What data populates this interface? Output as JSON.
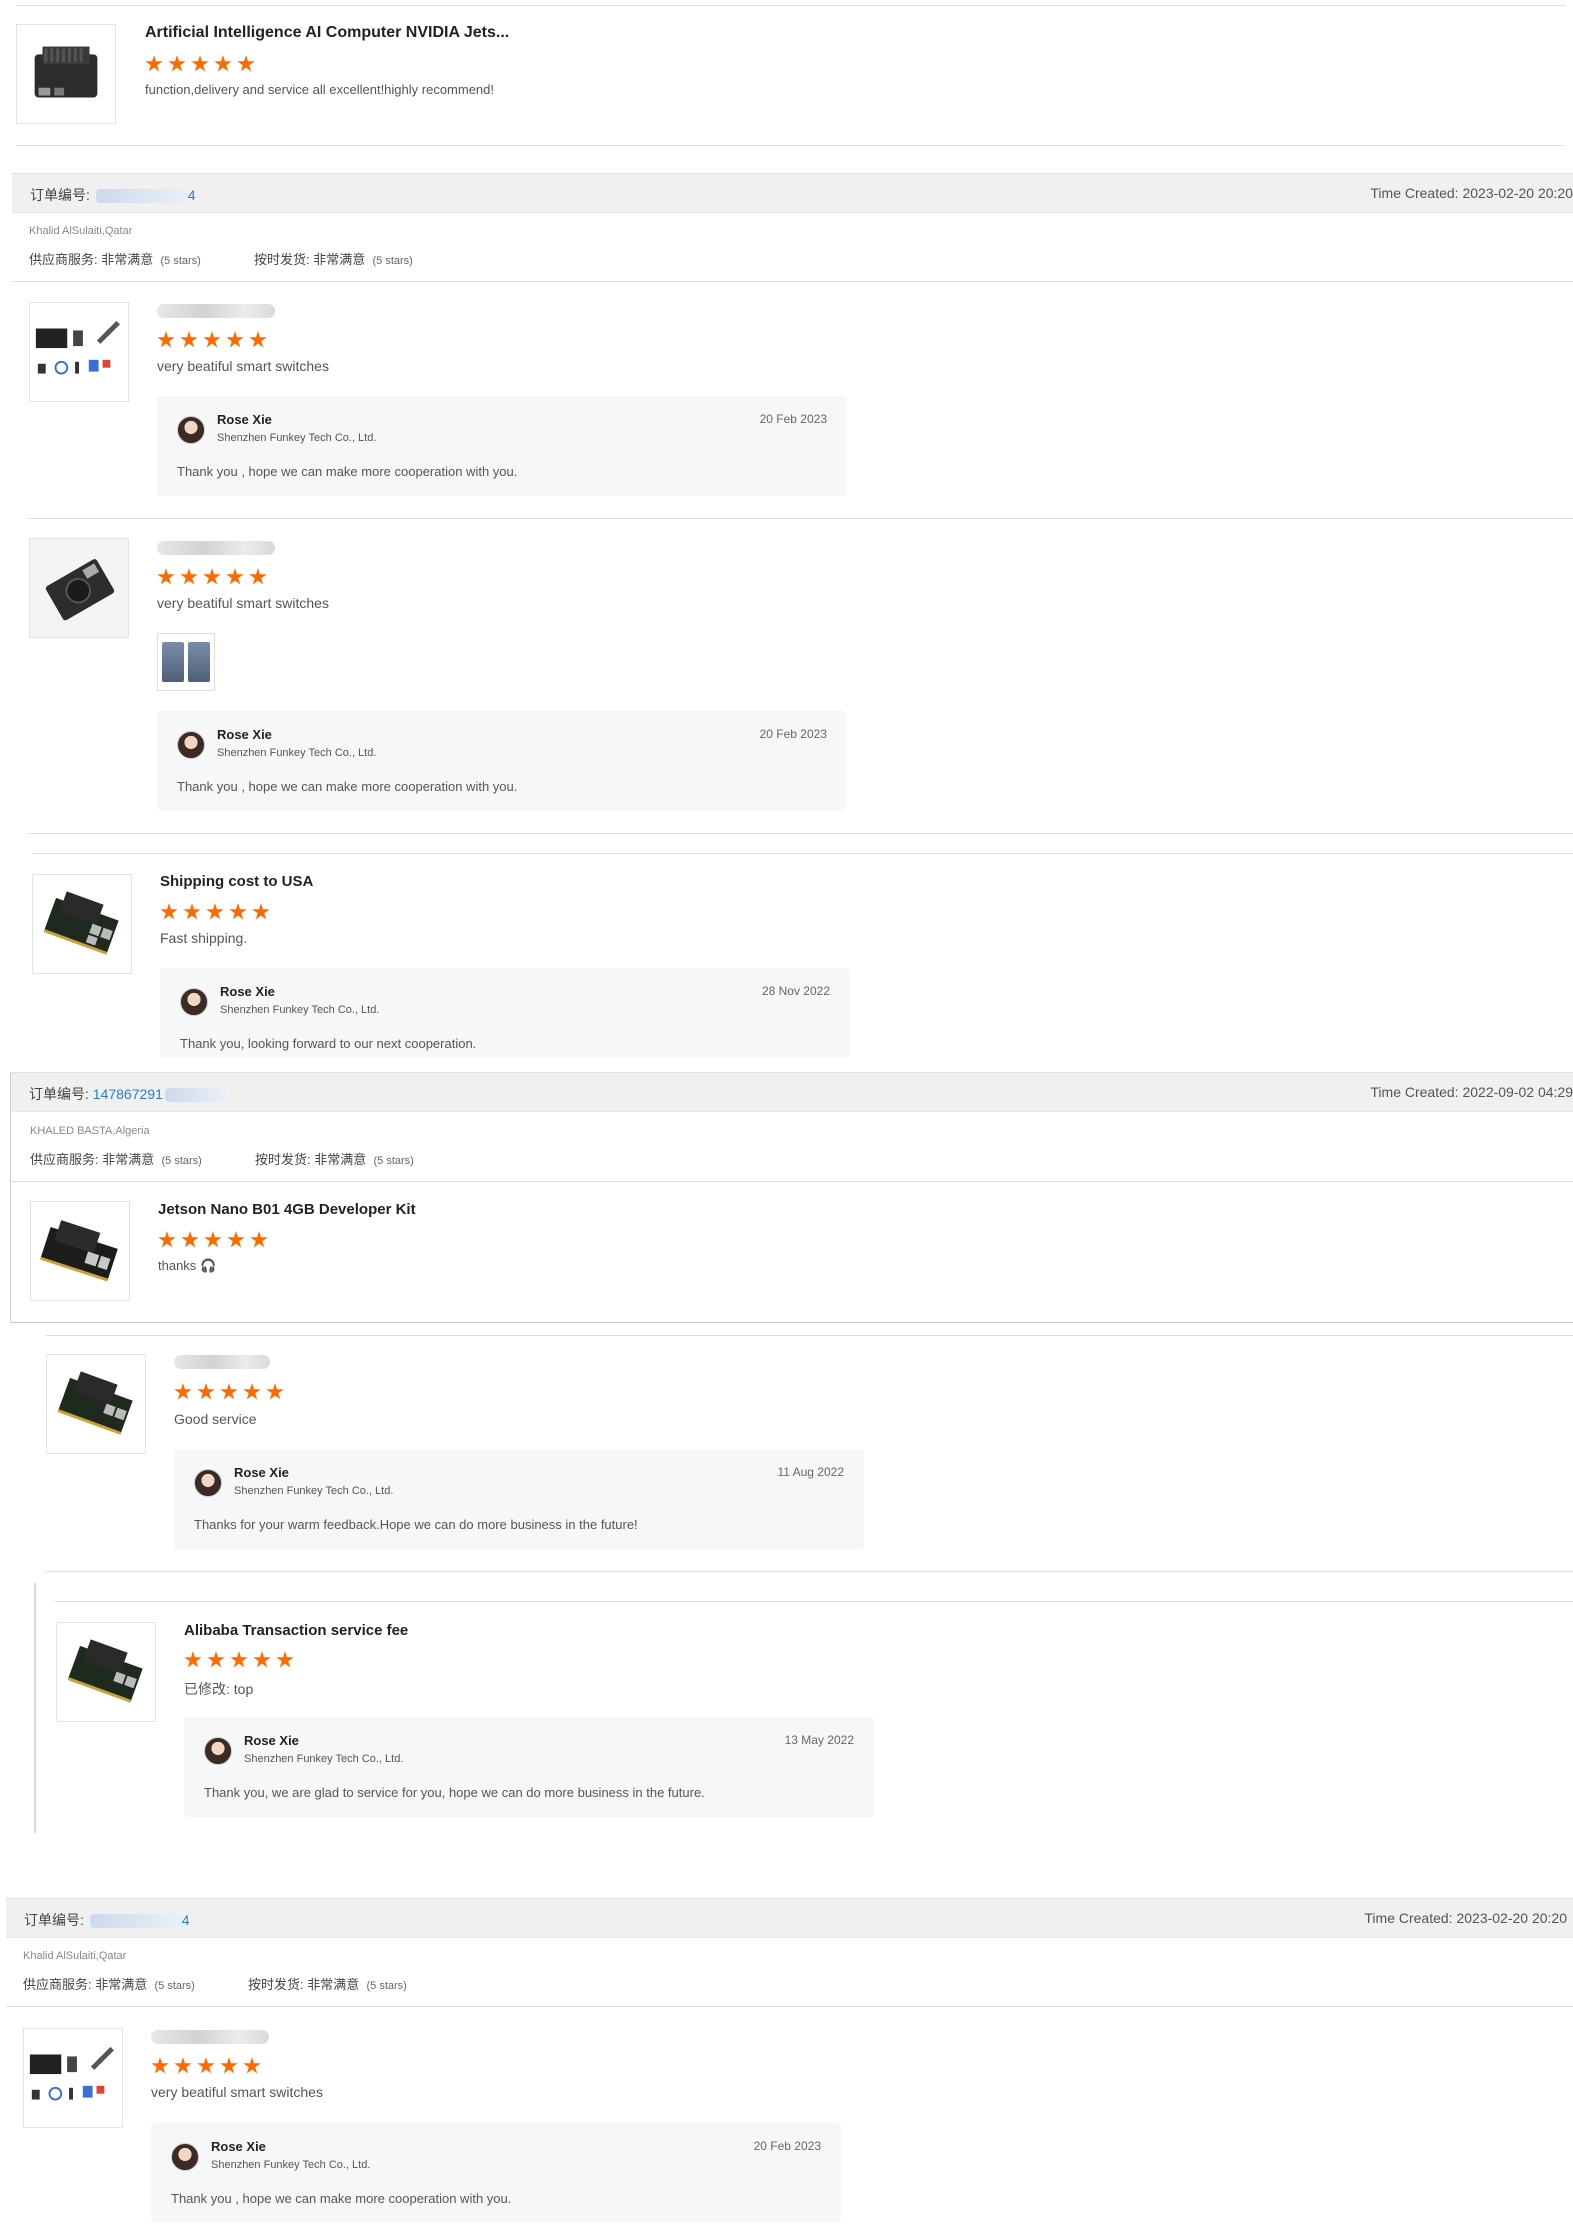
{
  "colors": {
    "star": "#ff6a00",
    "link": "#2b7bd1",
    "order_bar_bg": "#f0f0f0",
    "reply_bg": "#f6f7f8"
  },
  "icons": {
    "star": "star-icon",
    "avatar": "seller-avatar",
    "headset": "headset-icon"
  },
  "labels": {
    "order_no": "订单编号: ",
    "supplier_service": "供应商服务: ",
    "on_time": "按时发货: ",
    "very_satisfied": "非常满意",
    "five_stars": "(5 stars)"
  },
  "reviews": {
    "r1": {
      "title": "Artificial Intelligence AI Computer NVIDIA Jets...",
      "rating": 5,
      "text": "function,delivery and service all excellent!highly recommend!"
    },
    "r2": {
      "rating": 5,
      "text": "very beatiful smart switches"
    },
    "r3": {
      "rating": 5,
      "text": "very beatiful smart switches"
    },
    "r4": {
      "title": "Shipping cost to USA",
      "rating": 5,
      "text": "Fast shipping."
    },
    "r5": {
      "title": "Jetson Nano B01 4GB Developer Kit",
      "rating": 5,
      "text": "thanks"
    },
    "r6": {
      "rating": 5,
      "text": "Good service"
    },
    "r7": {
      "title": "Alibaba Transaction service fee",
      "rating": 5,
      "text": "已修改: top"
    },
    "r8": {
      "rating": 5,
      "text": "very beatiful smart switches"
    }
  },
  "orders": {
    "o1": {
      "number_visible": "4",
      "time": "Time Created: 2023-02-20 20:20",
      "buyer": "Khalid AlSulaiti,Qatar"
    },
    "o2": {
      "number_visible": "147867291",
      "time": "Time Created: 2022-09-02 04:29",
      "buyer": "KHALED BASTA,Algeria"
    },
    "o3": {
      "number_visible": "4",
      "time": "Time Created: 2023-02-20 20:20",
      "buyer": "Khalid AlSulaiti,Qatar"
    }
  },
  "replies": {
    "seller_name": "Rose Xie",
    "company": "Shenzhen Funkey Tech Co., Ltd.",
    "a": {
      "date": "20 Feb 2023",
      "msg": "Thank you , hope we can make more cooperation with you."
    },
    "b": {
      "date": "20 Feb 2023",
      "msg": "Thank you , hope we can make more cooperation with you."
    },
    "c": {
      "date": "28 Nov 2022",
      "msg": "Thank you, looking forward to our next cooperation."
    },
    "d": {
      "date": "11 Aug 2022",
      "msg": "Thanks for your warm feedback.Hope we can do more business in the future!"
    },
    "e": {
      "date": "13 May 2022",
      "msg": "Thank you, we are glad to service for you, hope we can do more business in the future."
    },
    "f": {
      "date": "20 Feb 2023",
      "msg": "Thank you , hope we can make more cooperation with you."
    }
  }
}
